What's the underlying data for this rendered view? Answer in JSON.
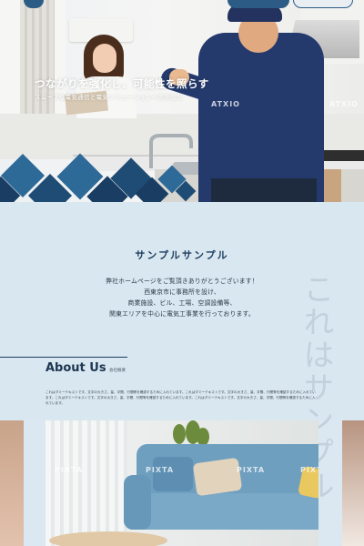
{
  "hero": {
    "title": "つながりを強化し、可能性を照らす",
    "subtitle": "スムーズな電気通信と電気ソリューションへのあなた",
    "watermarks": [
      "ATXIO",
      "ATXIO"
    ]
  },
  "intro": {
    "title": "サンプルサンプル",
    "lines": [
      "弊社ホームページをご覧頂きありがとうございます！",
      "西東京市に事務所を設け、",
      "商業施設、ビル、工場、空調設備等、",
      "関東エリアを中心に電気工事業を行っております。"
    ],
    "vertical_deco": "これはサンプル"
  },
  "about": {
    "title": "About Us",
    "subtitle": "会社概要",
    "body": "これはダミーテキストです。文字の大きさ、量、字間、行間等を確認するために入れています。これはダミーテキストです。文字の大きさ、量、字間、行間等を確認するために入れています。これはダミーテキストです。文字の大きさ、量、字間、行間等を確認するために入れています。これはダミーテキストです。文字の大きさ、量、字間、行間等を確認するために入れています。"
  },
  "living": {
    "watermarks": [
      "PIXTA",
      "PIXTA",
      "PIXTA",
      "PIXTA"
    ]
  },
  "colors": {
    "navy": "#1f4c74",
    "section_bg": "#d9e7f1",
    "heading": "#1e3e5e"
  }
}
